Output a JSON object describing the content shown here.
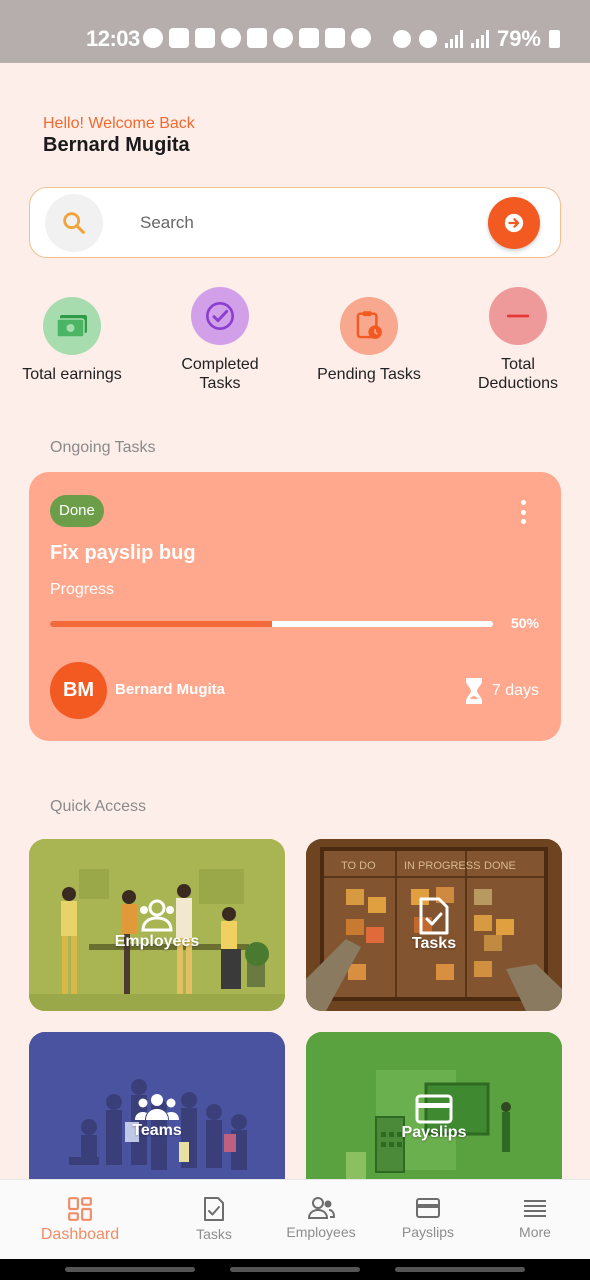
{
  "status_bar": {
    "time": "12:03",
    "battery": "79%"
  },
  "header": {
    "greeting": "Hello! Welcome Back",
    "user_name": "Bernard Mugita"
  },
  "search": {
    "placeholder": "Search"
  },
  "stats": [
    {
      "label": "Total earnings",
      "icon": "money-icon",
      "color": "#a6dcae"
    },
    {
      "label": "Completed Tasks",
      "icon": "check-circle-icon",
      "color": "#d2a0e8"
    },
    {
      "label": "Pending Tasks",
      "icon": "clipboard-clock-icon",
      "color": "#f8a88e"
    },
    {
      "label": "Total Deductions",
      "icon": "minus-circle-icon",
      "color": "#ef9a9a"
    }
  ],
  "ongoing": {
    "section_title": "Ongoing Tasks",
    "task": {
      "status": "Done",
      "title": "Fix payslip bug",
      "progress_label": "Progress",
      "progress": 0.5,
      "progress_text": "50%",
      "assignee_initials": "BM",
      "assignee": "Bernard Mugita",
      "duration": "7 days"
    }
  },
  "quick_access": {
    "section_title": "Quick Access",
    "tiles": [
      {
        "label": "Employees",
        "icon": "employees-icon",
        "color": "#a4b24c"
      },
      {
        "label": "Tasks",
        "icon": "task-document-icon",
        "color": "#7a4a22"
      },
      {
        "label": "Teams",
        "icon": "teams-icon",
        "color": "#4a52a0"
      },
      {
        "label": "Payslips",
        "icon": "payslip-card-icon",
        "color": "#5aa03e"
      }
    ]
  },
  "bottom_nav": [
    {
      "label": "Dashboard",
      "icon": "dashboard-icon",
      "active": true
    },
    {
      "label": "Tasks",
      "icon": "tasks-icon",
      "active": false
    },
    {
      "label": "Employees",
      "icon": "employees-icon",
      "active": false
    },
    {
      "label": "Payslips",
      "icon": "payslips-icon",
      "active": false
    },
    {
      "label": "More",
      "icon": "menu-icon",
      "active": false
    }
  ],
  "colors": {
    "accent": "#f25a22",
    "background": "#fdeeea",
    "card": "#ffa88d"
  }
}
